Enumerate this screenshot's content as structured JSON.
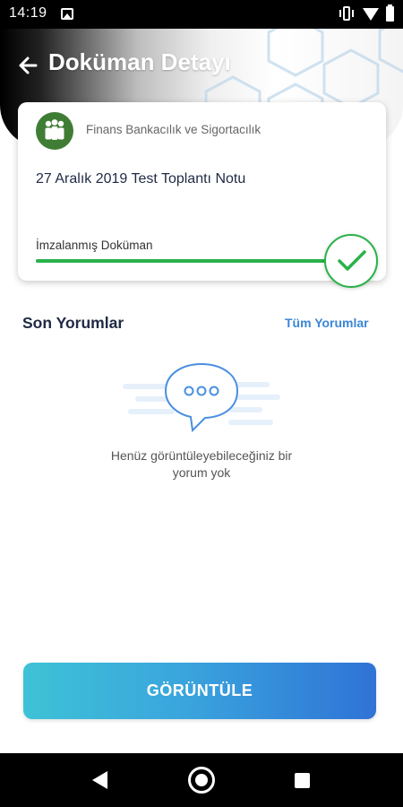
{
  "status_bar": {
    "time": "14:19",
    "icons": [
      "gallery-icon",
      "vibrate-icon",
      "wifi-icon",
      "battery-icon"
    ]
  },
  "header": {
    "title": "Doküman Detayı",
    "back_icon": "arrow-left-icon"
  },
  "document": {
    "organization": "Finans Bankacılık ve Sigortacılık",
    "organization_icon": "people-group-icon",
    "title": "27 Aralık 2019 Test Toplantı Notu",
    "status": "İmzalanmış Doküman",
    "progress": 1.0,
    "status_icon": "checkmark-icon"
  },
  "comments": {
    "heading": "Son Yorumlar",
    "all_link": "Tüm Yorumlar",
    "empty_line1": "Henüz görüntüleyebileceğiniz bir",
    "empty_line2": "yorum yok",
    "empty_icon": "chat-bubble-icon"
  },
  "actions": {
    "view_label": "GÖRÜNTÜLE"
  },
  "colors": {
    "accent_green": "#2ab24a",
    "avatar_green": "#3f7d35",
    "link_blue": "#3b86d6",
    "button_gradient_start": "#3ec2d6",
    "button_gradient_end": "#2f73d6",
    "heading_navy": "#1f2a44"
  },
  "nav_bar": {
    "icons": [
      "nav-back-icon",
      "nav-home-icon",
      "nav-recents-icon"
    ]
  }
}
